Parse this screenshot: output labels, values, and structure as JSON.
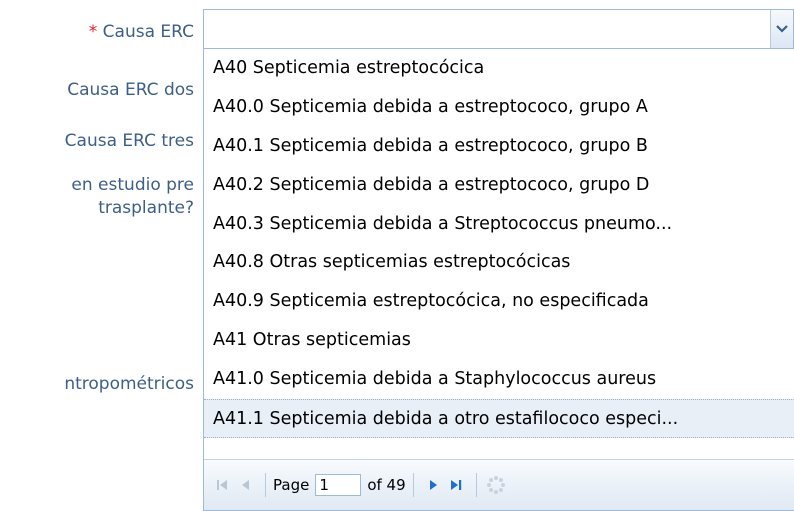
{
  "form": {
    "required_marker": "*",
    "labels": {
      "causa_erc": "Causa ERC",
      "causa_erc_dos": "Causa ERC dos",
      "causa_erc_tres": "Causa ERC tres",
      "estudio_line1": "en estudio pre",
      "estudio_line2": "trasplante?",
      "antropometricos": "ntropométricos"
    }
  },
  "combo": {
    "value": "",
    "trigger_icon": "chevron-down-icon"
  },
  "dropdown": {
    "items": [
      "A40 Septicemia estreptocócica",
      "A40.0 Septicemia debida a estreptococo, grupo A",
      "A40.1 Septicemia debida a estreptococo, grupo B",
      "A40.2 Septicemia debida a estreptococo, grupo D",
      "A40.3 Septicemia debida a Streptococcus pneumo...",
      "A40.8 Otras septicemias estreptocócicas",
      "A40.9 Septicemia estreptocócica, no especificada",
      "A41 Otras septicemias",
      "A41.0 Septicemia debida a Staphylococcus aureus",
      "A41.1 Septicemia debida a otro estafilococo especi..."
    ],
    "selected_index": 9,
    "pager": {
      "page_label": "Page",
      "page_value": "1",
      "of_label": "of 49",
      "icons": [
        "first-page-icon",
        "prev-page-icon",
        "next-page-icon",
        "last-page-icon",
        "refresh-icon"
      ]
    }
  },
  "colors": {
    "label": "#3d5f86",
    "required": "#e0202a",
    "accent": "#1f6fd1",
    "border": "#9ebad8"
  }
}
